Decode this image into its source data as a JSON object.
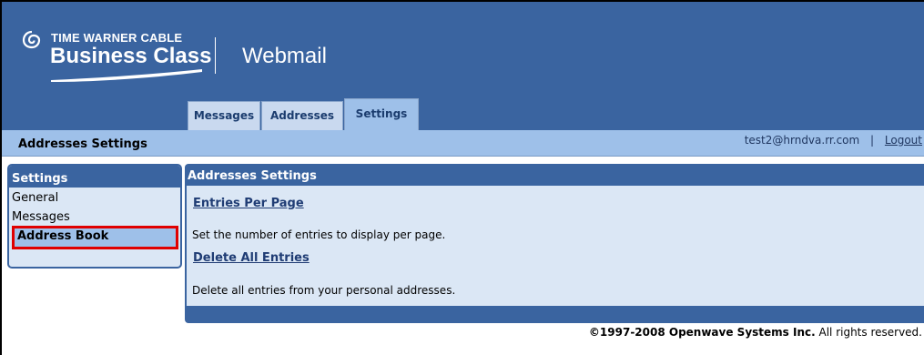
{
  "logo": {
    "line1": "TIME WARNER CABLE",
    "line2": "Business Class"
  },
  "app": {
    "title": "Webmail"
  },
  "tabs": [
    {
      "label": "Messages",
      "active": false
    },
    {
      "label": "Addresses",
      "active": false
    },
    {
      "label": "Settings",
      "active": true
    }
  ],
  "subbar": {
    "title": "Addresses Settings",
    "user_email": "test2@hrndva.rr.com",
    "separator": "|",
    "logout_label": "Logout"
  },
  "sidebar": {
    "heading": "Settings",
    "items": [
      {
        "label": "General"
      },
      {
        "label": "Messages"
      },
      {
        "label": "Address Book",
        "selected": true
      }
    ]
  },
  "main": {
    "heading": "Addresses Settings",
    "sections": [
      {
        "link": "Entries Per Page",
        "description": "Set the number of entries to display per page."
      },
      {
        "link": "Delete All Entries",
        "description": "Delete all entries from your personal addresses."
      }
    ]
  },
  "footer": {
    "company": "©1997-2008 Openwave Systems Inc.",
    "rights": "All rights reserved."
  },
  "colors": {
    "header_blue": "#3a64a0",
    "light_blue": "#9ec0e9",
    "panel_bg": "#dbe7f5",
    "highlight_red": "#e00000"
  }
}
